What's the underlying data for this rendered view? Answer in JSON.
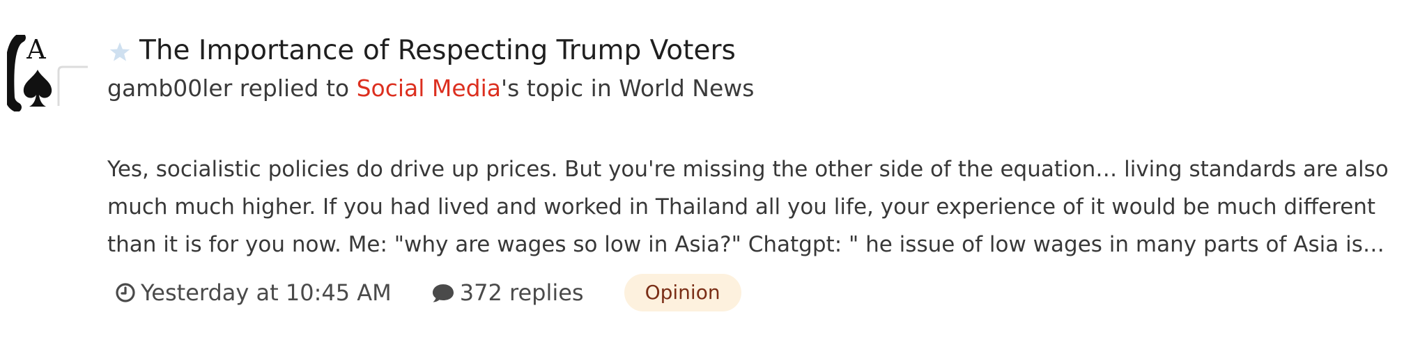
{
  "activity": {
    "title": "The Importance of Respecting Trump Voters",
    "author": "gamb00ler",
    "action_text": " replied to ",
    "original_author": "Social Media",
    "topic_in_text": "'s topic in ",
    "forum": "World News",
    "snippet": "Yes, socialistic policies do drive up prices. But you're missing the other side of the equation… living standards are also much much higher. If you had lived and worked in Thailand all you life, your experience of it would be much different than it is for you now. Me: \"why are wages so low in Asia?\" Chatgpt: \" he issue of low wages in many parts of Asia is…",
    "timestamp": "Yesterday at 10:45 AM",
    "replies": "372 replies",
    "tag": "Opinion"
  },
  "avatar": {
    "card_rank": "A"
  },
  "icons": {
    "star": "star-icon",
    "clock": "clock-icon",
    "comment": "comment-icon"
  },
  "colors": {
    "link_red": "#dc2f1f",
    "star_light_blue": "#cfe0f0",
    "tag_background": "#fdf1de",
    "tag_text": "#7a2e16"
  }
}
